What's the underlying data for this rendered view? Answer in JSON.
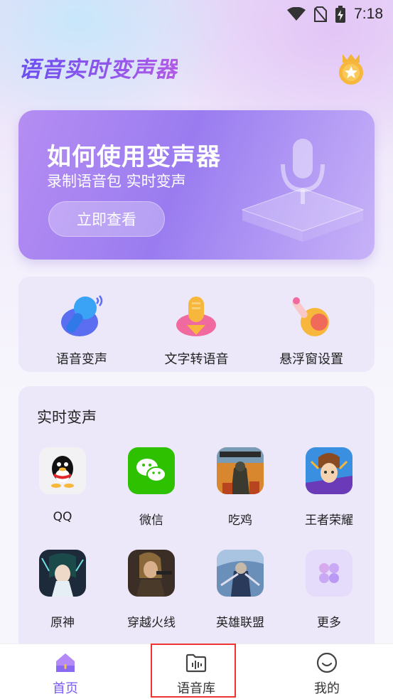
{
  "status_bar": {
    "time": "7:18"
  },
  "header": {
    "app_title": "语音实时变声器"
  },
  "banner": {
    "title": "如何使用变声器",
    "subtitle": "录制语音包 实时变声",
    "button_label": "立即查看"
  },
  "tools": [
    {
      "label": "语音变声",
      "icon": "microphone-icon"
    },
    {
      "label": "文字转语音",
      "icon": "text-to-speech-icon"
    },
    {
      "label": "悬浮窗设置",
      "icon": "floating-window-icon"
    }
  ],
  "realtime": {
    "title": "实时变声",
    "apps": [
      {
        "label": "QQ",
        "icon": "qq-icon"
      },
      {
        "label": "微信",
        "icon": "wechat-icon"
      },
      {
        "label": "吃鸡",
        "icon": "pubg-icon"
      },
      {
        "label": "王者荣耀",
        "icon": "honor-of-kings-icon"
      },
      {
        "label": "原神",
        "icon": "genshin-icon"
      },
      {
        "label": "穿越火线",
        "icon": "crossfire-icon"
      },
      {
        "label": "英雄联盟",
        "icon": "league-of-legends-icon"
      },
      {
        "label": "更多",
        "icon": "more-icon"
      }
    ]
  },
  "bottom_nav": [
    {
      "label": "首页",
      "icon": "home-icon",
      "active": true
    },
    {
      "label": "语音库",
      "icon": "voice-library-icon",
      "active": false
    },
    {
      "label": "我的",
      "icon": "profile-icon",
      "active": false
    }
  ],
  "colors": {
    "accent": "#7a5af0",
    "highlight": "#ee3333"
  }
}
